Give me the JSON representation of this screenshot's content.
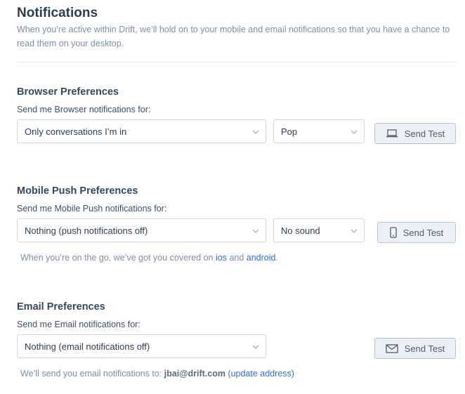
{
  "header": {
    "title": "Notifications",
    "description": "When you’re active within Drift, we’ll hold on to your mobile and email notifications so that you have a chance to read them on your desktop."
  },
  "browser": {
    "title": "Browser Preferences",
    "subtitle": "Send me Browser notifications for:",
    "scope_value": "Only conversations I’m in",
    "sound_value": "Pop",
    "test_label": "Send Test"
  },
  "mobile": {
    "title": "Mobile Push Preferences",
    "subtitle": "Send me Mobile Push notifications for:",
    "scope_value": "Nothing (push notifications off)",
    "sound_value": "No sound",
    "test_label": "Send Test",
    "note_prefix": "When you’re on the go, we’ve got you covered on",
    "ios_link": "ios",
    "and_text": "and",
    "android_link": "android",
    "note_suffix": "."
  },
  "email": {
    "title": "Email Preferences",
    "subtitle": "Send me Email notifications for:",
    "scope_value": "Nothing (email notifications off)",
    "test_label": "Send Test",
    "note_prefix": "We’ll send you email notifications to:",
    "address": "jbai@drift.com",
    "update_link": "(update address)"
  }
}
